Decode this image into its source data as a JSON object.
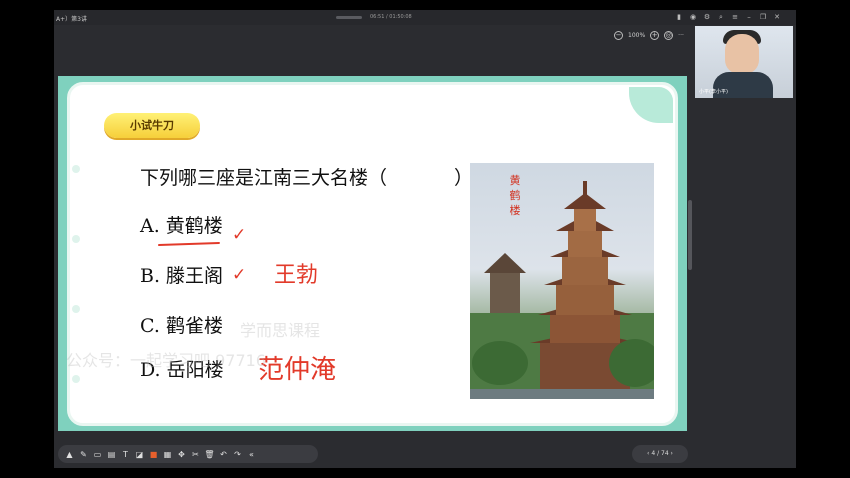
{
  "window": {
    "title": "A+）第3讲",
    "time": "06:51 / 01:50:08",
    "zoom": "100%"
  },
  "slide": {
    "tag": "小试牛刀",
    "question": "下列哪三座是江南三大名楼（",
    "question_close": "）",
    "options": [
      {
        "label": "A. 黄鹤楼",
        "mark": "✓"
      },
      {
        "label": "B. 滕王阁",
        "mark": "✓"
      },
      {
        "label": "C. 鹳雀楼",
        "mark": ""
      },
      {
        "label": "D. 岳阳楼",
        "mark": ""
      }
    ],
    "handwriting": [
      "王勃",
      "范仲淹"
    ],
    "photo_caption": "黄鹤楼",
    "watermark_1": "学而思课程",
    "watermark_2": "公众号：一起学习吧  97716"
  },
  "pager": {
    "text": "‹  4 / 74  ›"
  },
  "camera": {
    "name": "小平(李小平)"
  },
  "colors": {
    "slide_bg": "#7fd1be",
    "tag": "#f6cf3a",
    "ink": "#e23a2a"
  },
  "icons": [
    "cone-icon",
    "brush-icon",
    "eraser-icon",
    "note-icon",
    "text-icon",
    "shape-icon",
    "color-icon",
    "grid-icon",
    "move-icon",
    "cut-icon",
    "delete-icon",
    "undo-icon",
    "redo-icon",
    "collapse-icon"
  ]
}
